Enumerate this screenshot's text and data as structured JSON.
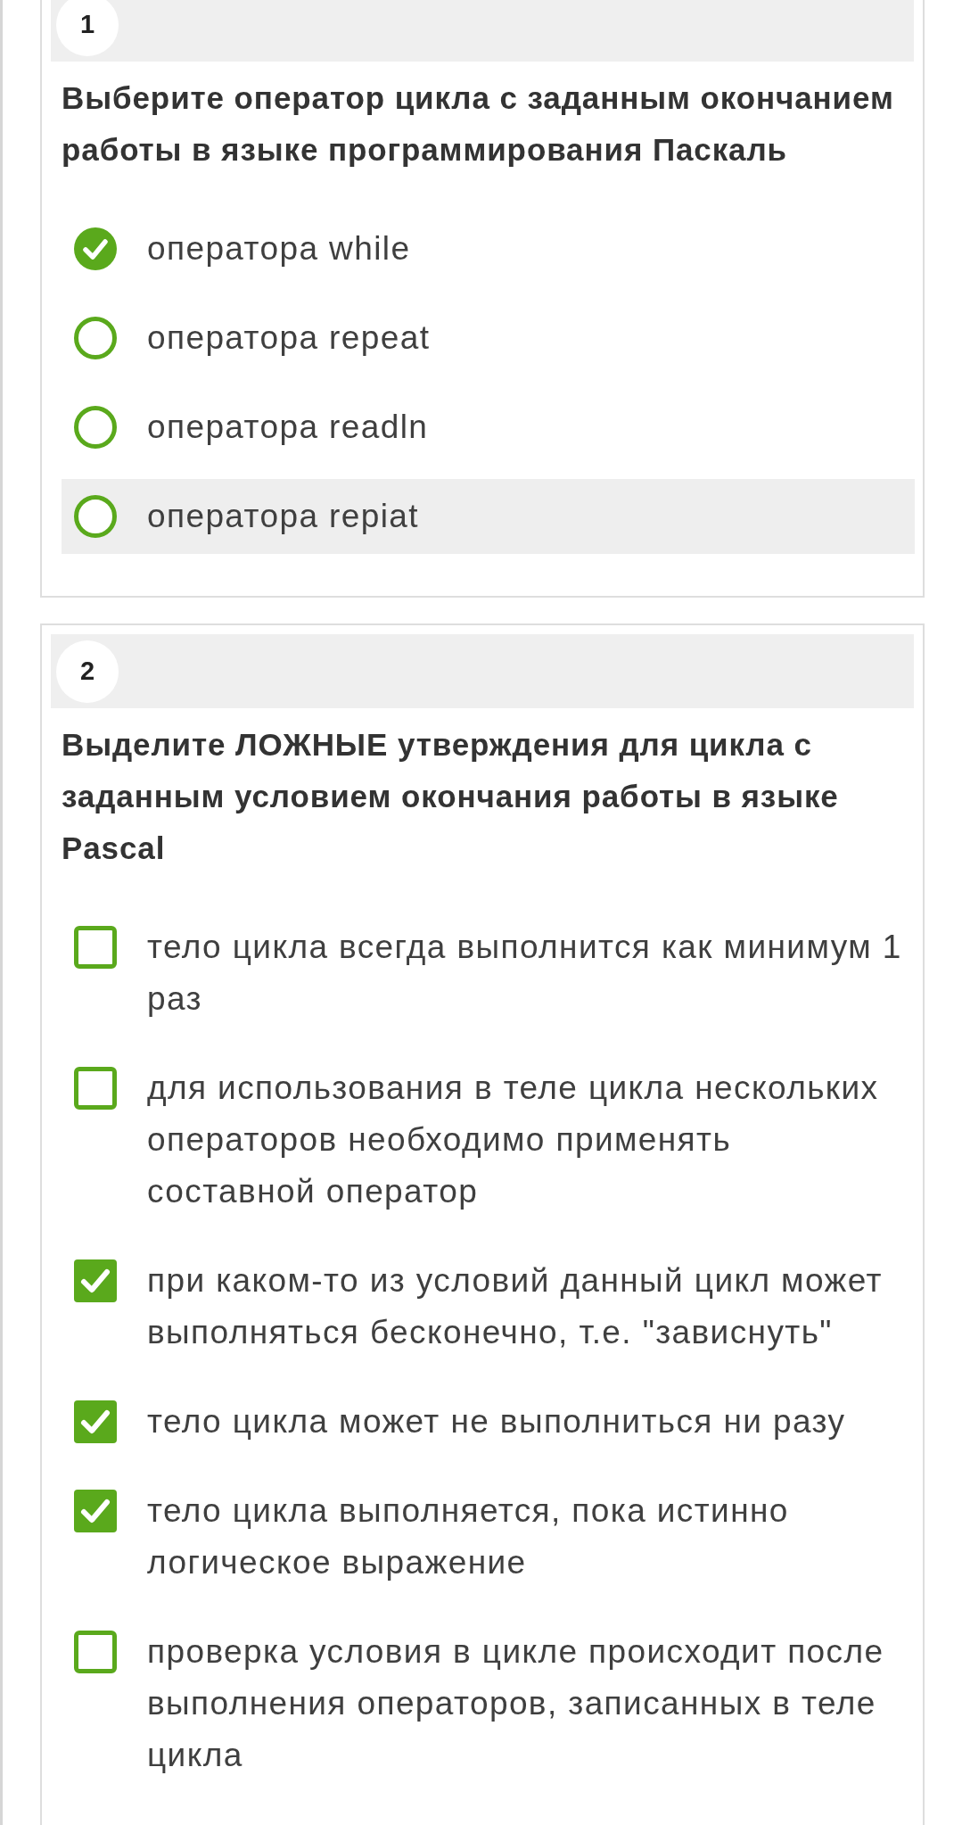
{
  "questions": [
    {
      "number": "1",
      "kind": "single",
      "prompt": "Выберите оператор цикла с заданным окончанием работы в языке программирования Паскаль",
      "options": [
        {
          "text": "оператора while",
          "selected": true,
          "highlighted": false
        },
        {
          "text": "оператора repeat",
          "selected": false,
          "highlighted": false
        },
        {
          "text": "оператора readln",
          "selected": false,
          "highlighted": false
        },
        {
          "text": "оператора repiat",
          "selected": false,
          "highlighted": true
        }
      ]
    },
    {
      "number": "2",
      "kind": "multiple",
      "prompt": "Выделите ЛОЖНЫЕ утверждения для цикла с заданным условием окончания работы в языке Pascal",
      "options": [
        {
          "text": "тело цикла всегда выполнится как минимум 1 раз",
          "checked": false,
          "highlighted": false
        },
        {
          "text": "для использования в теле цикла нескольких операторов необходимо применять составной оператор",
          "checked": false,
          "highlighted": false
        },
        {
          "text": "при каком-то из условий данный цикл может выполняться бесконечно, т.е. \"зависнуть\"",
          "checked": true,
          "highlighted": false
        },
        {
          "text": "тело цикла может не выполниться ни разу",
          "checked": true,
          "highlighted": false
        },
        {
          "text": "тело цикла выполняется, пока истинно логическое выражение",
          "checked": true,
          "highlighted": false
        },
        {
          "text": "проверка условия в цикле происходит после выполнения операторов, записанных в теле цикла",
          "checked": false,
          "highlighted": false
        }
      ]
    }
  ]
}
